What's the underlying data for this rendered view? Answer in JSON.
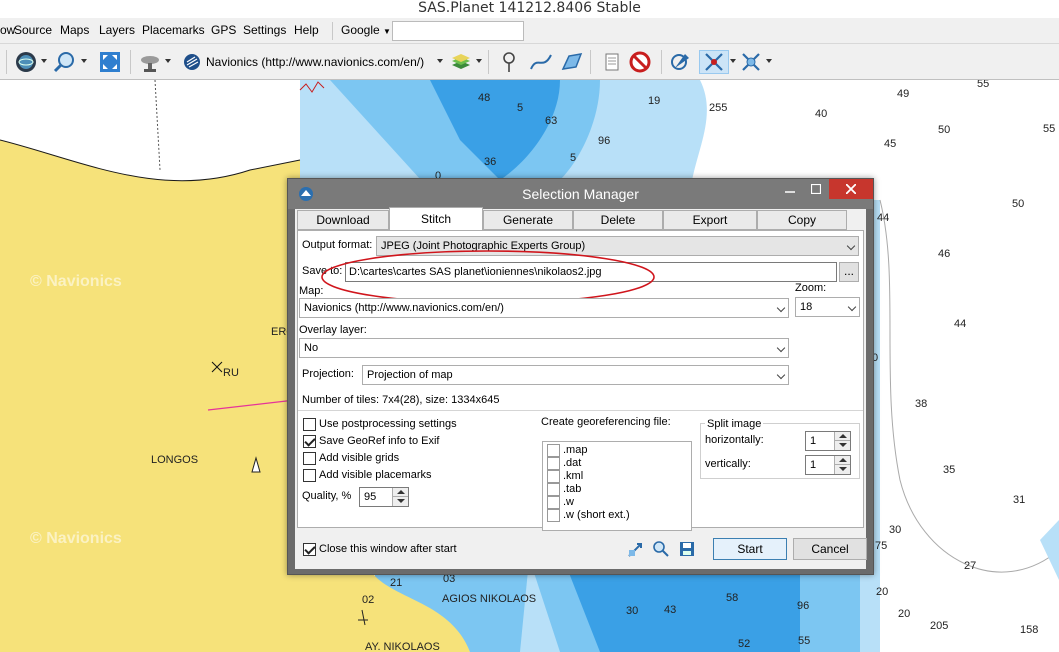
{
  "app": {
    "title": "SAS.Planet 141212.8406 Stable"
  },
  "menu": {
    "items": [
      "ow",
      "Source",
      "Maps",
      "Layers",
      "Placemarks",
      "GPS",
      "Settings",
      "Help"
    ],
    "search_engine": "Google",
    "search_value": ""
  },
  "toolbar": {
    "map_source": "Navionics (http://www.navionics.com/en/)",
    "icons": [
      "globe-icon",
      "zoom-icon",
      "fullscreen-icon",
      "satellite-icon",
      "navionics-logo-icon",
      "layers-icon",
      "placemark-icon",
      "path-icon",
      "polygon-icon",
      "notes-icon",
      "no-entry-icon",
      "gps-icon",
      "gps-follow-icon",
      "gps-center-icon"
    ]
  },
  "map": {
    "watermark": "© Navionics",
    "places": [
      "ERO",
      "RU",
      "LONGOS",
      "AGIOS NIKOLAOS",
      "AY. NIKOLAOS"
    ],
    "depths": [
      "48",
      "5",
      "19",
      "255",
      "40",
      "49",
      "55",
      "63",
      "96",
      "45",
      "50",
      "55",
      "36",
      "5",
      "0",
      "44",
      "50",
      "46",
      "44",
      "38",
      "35",
      "31",
      "30",
      "27",
      "75",
      "21",
      "03",
      "02",
      "58",
      "96",
      "20",
      "43",
      "52",
      "205",
      "158",
      "20",
      "55",
      "0",
      "30"
    ]
  },
  "dialog": {
    "title": "Selection Manager",
    "tabs": [
      "Download",
      "Stitch",
      "Generate",
      "Delete",
      "Export",
      "Copy"
    ],
    "output_format_label": "Output format:",
    "output_format_value": "JPEG (Joint Photographic Experts Group)",
    "save_to_label": "Save to:",
    "save_to_value": "D:\\cartes\\cartes SAS planet\\ioniennes\\nikolaos2.jpg",
    "browse_label": "...",
    "map_label": "Map:",
    "map_value": "Navionics (http://www.navionics.com/en/)",
    "zoom_label": "Zoom:",
    "zoom_value": "18",
    "overlay_label": "Overlay layer:",
    "overlay_value": "No",
    "projection_label": "Projection:",
    "projection_value": "Projection of map",
    "tiles_info": "Number of tiles: 7x4(28), size: 1334x645",
    "options": [
      {
        "label": "Use postprocessing settings",
        "checked": false
      },
      {
        "label": "Save GeoRef info to Exif",
        "checked": true
      },
      {
        "label": "Add visible grids",
        "checked": false
      },
      {
        "label": "Add visible placemarks",
        "checked": false
      }
    ],
    "quality_label": "Quality, %",
    "quality_value": "95",
    "georef_label": "Create georeferencing file:",
    "georef_items": [
      ".map",
      ".dat",
      ".kml",
      ".tab",
      ".w",
      ".w (short ext.)"
    ],
    "split_label": "Split image",
    "split_h_label": "horizontally:",
    "split_h_value": "1",
    "split_v_label": "vertically:",
    "split_v_value": "1",
    "close_after_label": "Close this window after start",
    "start_label": "Start",
    "cancel_label": "Cancel"
  },
  "colors": {
    "land": "#f6e27a",
    "shallow": "#3aa0e6",
    "mid": "#7cc6f2",
    "deep": "#b8e0f8",
    "annotation": "#d0151c"
  }
}
